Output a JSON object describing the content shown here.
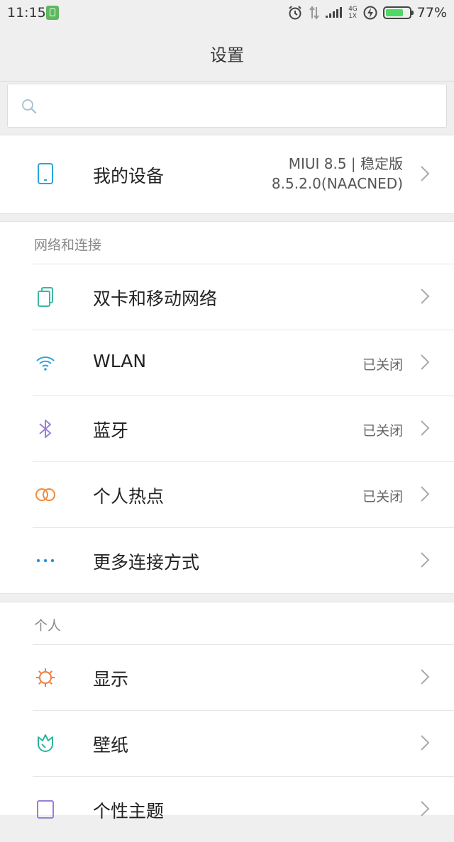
{
  "status_bar": {
    "time": "11:15",
    "battery_percent": "77%",
    "battery_level": 0.77,
    "network_label_top": "4G",
    "network_label_bottom": "1X"
  },
  "header": {
    "title": "设置"
  },
  "search": {
    "placeholder": ""
  },
  "device": {
    "label": "我的设备",
    "version_line1": "MIUI 8.5 | 稳定版",
    "version_line2": "8.5.2.0(NAACNED)"
  },
  "network": {
    "section_title": "网络和连接",
    "items": [
      {
        "label": "双卡和移动网络",
        "status": "",
        "icon": "dual-sim-icon",
        "color": "#3bb8a0"
      },
      {
        "label": "WLAN",
        "status": "已关闭",
        "icon": "wifi-icon",
        "color": "#2aa6d8"
      },
      {
        "label": "蓝牙",
        "status": "已关闭",
        "icon": "bluetooth-icon",
        "color": "#9a7fd6"
      },
      {
        "label": "个人热点",
        "status": "已关闭",
        "icon": "hotspot-icon",
        "color": "#f08a3c"
      },
      {
        "label": "更多连接方式",
        "status": "",
        "icon": "more-dots-icon",
        "color": "#2a8fd8"
      }
    ]
  },
  "personal": {
    "section_title": "个人",
    "items": [
      {
        "label": "显示",
        "status": "",
        "icon": "sun-icon",
        "color": "#f07c3c"
      },
      {
        "label": "壁纸",
        "status": "",
        "icon": "tulip-icon",
        "color": "#2bb59a"
      },
      {
        "label": "个性主题",
        "status": "",
        "icon": "theme-icon",
        "color": "#9a7fd6"
      }
    ]
  }
}
